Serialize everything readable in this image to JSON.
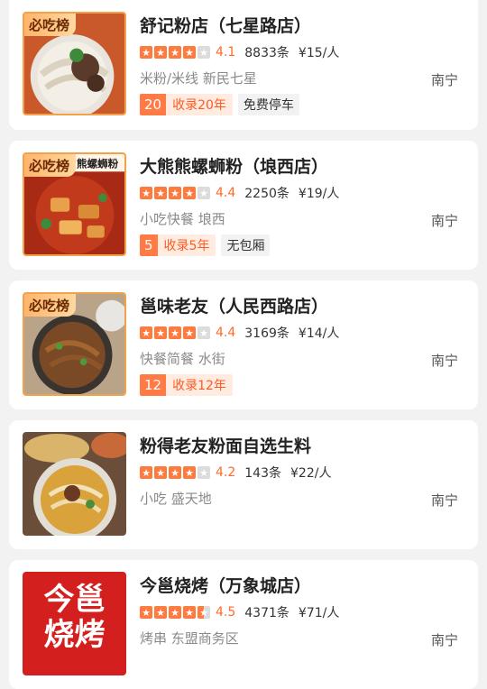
{
  "restaurants": [
    {
      "badge": "必吃榜",
      "name": "舒记粉店（七星路店）",
      "score": "4.1",
      "reviews": "8833条",
      "price": "¥15/人",
      "category": "米粉/米线 新民七星",
      "city": "南宁",
      "years_num": "20",
      "years_text": "收录20年",
      "extra_tag": "免费停车"
    },
    {
      "badge": "必吃榜",
      "name": "大熊熊螺蛳粉（埌西店）",
      "score": "4.4",
      "reviews": "2250条",
      "price": "¥19/人",
      "category": "小吃快餐 埌西",
      "city": "南宁",
      "years_num": "5",
      "years_text": "收录5年",
      "extra_tag": "无包厢",
      "photo_text": "熊螺蛳粉"
    },
    {
      "badge": "必吃榜",
      "name": "邕味老友（人民西路店）",
      "score": "4.4",
      "reviews": "3169条",
      "price": "¥14/人",
      "category": "快餐简餐 水街",
      "city": "南宁",
      "years_num": "12",
      "years_text": "收录12年"
    },
    {
      "name": "粉得老友粉面自选生料",
      "score": "4.2",
      "reviews": "143条",
      "price": "¥22/人",
      "category": "小吃 盛天地",
      "city": "南宁"
    },
    {
      "name": "今邕烧烤（万象城店）",
      "score": "4.5",
      "reviews": "4371条",
      "price": "¥71/人",
      "category": "烤串 东盟商务区",
      "city": "南宁",
      "logo_line1": "今邕",
      "logo_line2": "烧烤"
    }
  ],
  "star_levels": [
    4,
    4,
    4,
    4,
    4.5
  ],
  "colors": {
    "accent": "#ff7a3c",
    "badge": "#ffb56b",
    "logo": "#d3201f"
  }
}
